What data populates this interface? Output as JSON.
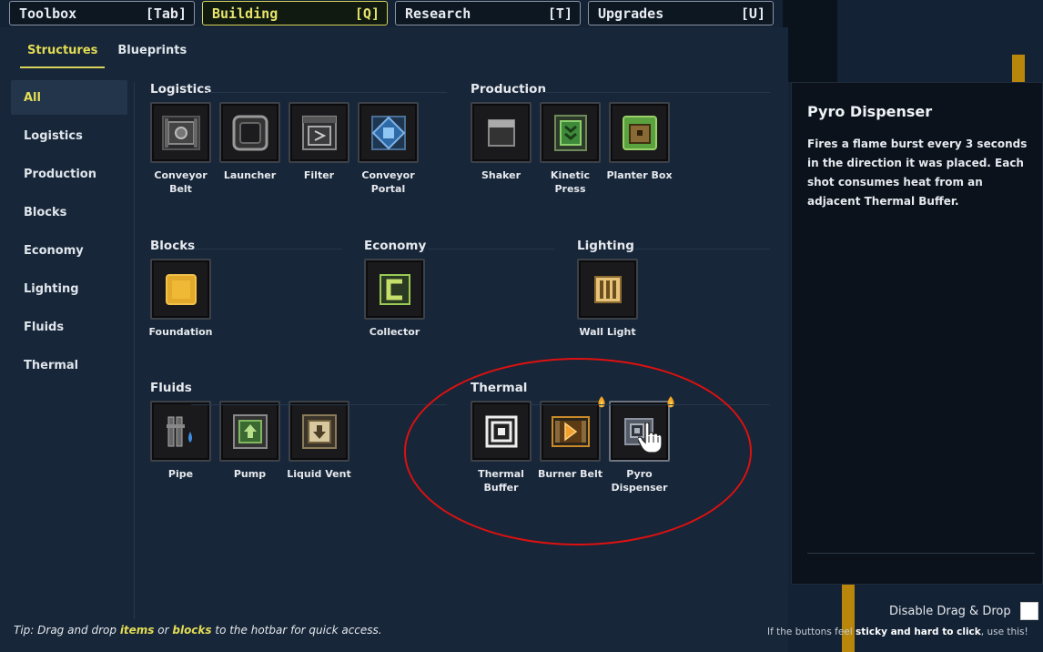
{
  "top_tabs": [
    {
      "label": "Toolbox",
      "key": "[Tab]"
    },
    {
      "label": "Building",
      "key": "[Q]"
    },
    {
      "label": "Research",
      "key": "[T]"
    },
    {
      "label": "Upgrades",
      "key": "[U]"
    }
  ],
  "active_top_tab": "Building",
  "sub_tabs": [
    "Structures",
    "Blueprints"
  ],
  "sidebar": [
    "All",
    "Logistics",
    "Production",
    "Blocks",
    "Economy",
    "Lighting",
    "Fluids",
    "Thermal"
  ],
  "sections": {
    "logistics": {
      "title": "Logistics",
      "items": [
        "Conveyor Belt",
        "Launcher",
        "Filter",
        "Conveyor Portal"
      ]
    },
    "production": {
      "title": "Production",
      "items": [
        "Shaker",
        "Kinetic Press",
        "Planter Box"
      ]
    },
    "blocks": {
      "title": "Blocks",
      "items": [
        "Foundation"
      ]
    },
    "economy": {
      "title": "Economy",
      "items": [
        "Collector"
      ]
    },
    "lighting": {
      "title": "Lighting",
      "items": [
        "Wall Light"
      ]
    },
    "fluids": {
      "title": "Fluids",
      "items": [
        "Pipe",
        "Pump",
        "Liquid Vent"
      ]
    },
    "thermal": {
      "title": "Thermal",
      "items": [
        "Thermal Buffer",
        "Burner Belt",
        "Pyro Dispenser"
      ]
    }
  },
  "info": {
    "title": "Pyro Dispenser",
    "description": "Fires a flame burst every 3 seconds in the direction it was placed. Each shot consumes heat from an adjacent Thermal Buffer."
  },
  "drag_toggle": {
    "label": "Disable Drag & Drop"
  },
  "hint": {
    "prefix": "If the buttons feel ",
    "bold": "sticky and hard to click",
    "suffix": ", use this!"
  },
  "tip": {
    "t1": "Tip: Drag and drop ",
    "items": "items",
    "t2": " or ",
    "blocks": "blocks",
    "t3": " to the hotbar for quick access."
  },
  "colors": {
    "accent": "#d7d35c",
    "panel": "#172638",
    "annotation": "#dd1111"
  }
}
